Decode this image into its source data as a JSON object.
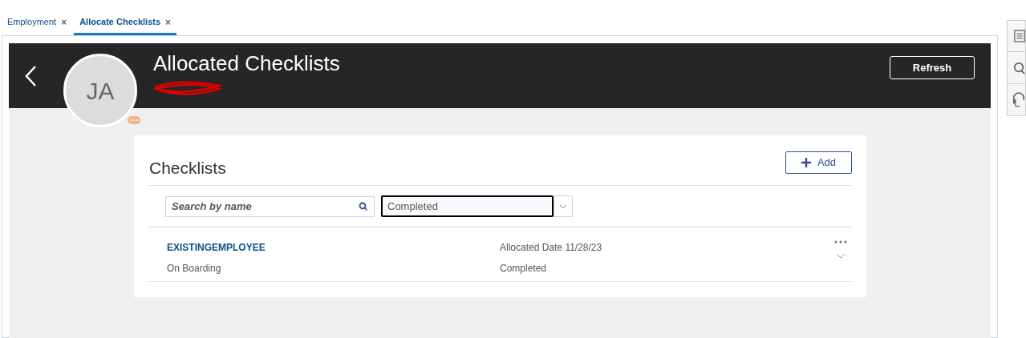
{
  "tabs": [
    {
      "label": "Employment",
      "selected": false,
      "close": "×"
    },
    {
      "label": "Allocate Checklists",
      "selected": true,
      "close": "×"
    }
  ],
  "header": {
    "title": "Allocated Checklists",
    "avatar_initials": "JA",
    "refresh_button": "Refresh"
  },
  "checklists": {
    "title": "Checklists",
    "add_button": "Add",
    "search": {
      "placeholder": "Search by name"
    },
    "status_filter": {
      "value": "Completed"
    },
    "rows": [
      {
        "name": "EXISTINGEMPLOYEE",
        "type": "On Boarding",
        "allocated": "Allocated Date 11/28/23",
        "status": "Completed"
      }
    ]
  }
}
